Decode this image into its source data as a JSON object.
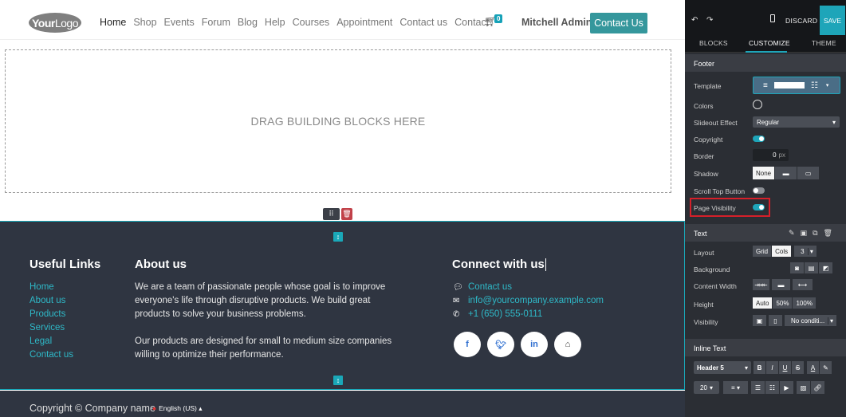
{
  "navbar": {
    "logo_bold": "Your",
    "logo_light": "Logo",
    "links": [
      "Home",
      "Shop",
      "Events",
      "Forum",
      "Blog",
      "Help",
      "Courses",
      "Appointment",
      "Contact us",
      "Contact"
    ],
    "cart_count": "0",
    "user_name": "Mitchell Admin",
    "contact_button": "Contact Us"
  },
  "dropzone": {
    "text": "DRAG BUILDING BLOCKS HERE"
  },
  "footer": {
    "useful_links_title": "Useful Links",
    "useful_links": [
      "Home",
      "About us",
      "Products",
      "Services",
      "Legal",
      "Contact us"
    ],
    "about_title": "About us",
    "about_p1": "We are a team of passionate people whose goal is to improve everyone's life through disruptive products. We build great products to solve your business problems.",
    "about_p2": "Our products are designed for small to medium size companies willing to optimize their performance.",
    "connect_title": "Connect with us",
    "connect_contact": "Contact us",
    "connect_email": "info@yourcompany.example.com",
    "connect_phone": "+1 (650) 555-0111",
    "socials": [
      "f",
      "t",
      "in",
      "home"
    ]
  },
  "copyright": {
    "text": "Copyright © Company name",
    "language": "English (US)"
  },
  "editor": {
    "discard": "DISCARD",
    "save": "SAVE",
    "tabs": [
      "BLOCKS",
      "CUSTOMIZE",
      "THEME"
    ],
    "footer_section": "Footer",
    "footer_rows": {
      "template": "Template",
      "colors": "Colors",
      "slideout": "Slideout Effect",
      "slideout_value": "Regular",
      "copyright": "Copyright",
      "border": "Border",
      "border_value": "0",
      "border_unit": "px",
      "shadow": "Shadow",
      "shadow_value": "None",
      "scroll_top": "Scroll Top Button",
      "page_visibility": "Page Visibility"
    },
    "text_section": "Text",
    "text_rows": {
      "layout": "Layout",
      "layout_grid": "Grid",
      "layout_cols": "Cols",
      "layout_count": "3",
      "background": "Background",
      "content_width": "Content Width",
      "height": "Height",
      "height_auto": "Auto",
      "height_50": "50%",
      "height_100": "100%",
      "visibility": "Visibility",
      "visibility_value": "No conditi..."
    },
    "inline_section": "Inline Text",
    "inline": {
      "style": "Header 5",
      "font_size": "20"
    },
    "toggles": {
      "copyright": true,
      "scroll_top": false,
      "page_visibility": true
    },
    "accent": "#1ea5b9"
  }
}
